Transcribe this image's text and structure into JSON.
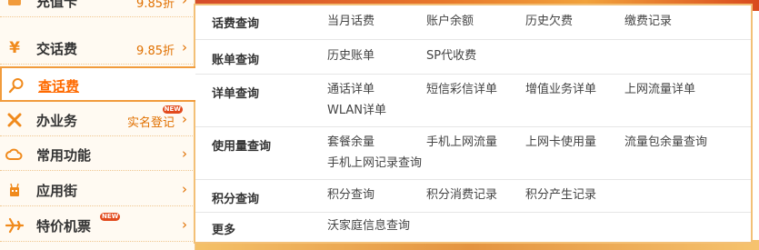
{
  "colors": {
    "accent": "#ff6a00",
    "popup_border": "#f3c077",
    "menu_background": "#fffaf2"
  },
  "left_menu": {
    "items": [
      {
        "label": "充值卡",
        "extra": "9.85折",
        "icon": "card-icon",
        "arrow": "›"
      },
      {
        "label": "交话费",
        "extra": "9.85折",
        "icon": "yuan-icon",
        "arrow": "›"
      },
      {
        "label": "查话费",
        "extra": "",
        "icon": "search-icon",
        "arrow": ""
      },
      {
        "label": "办业务",
        "extra": "实名登记",
        "icon": "tools-icon",
        "arrow": "›",
        "badge": "NEW"
      },
      {
        "label": "常用功能",
        "extra": "",
        "icon": "cloud-icon",
        "arrow": "›"
      },
      {
        "label": "应用街",
        "extra": "",
        "icon": "robot-icon",
        "arrow": "›"
      },
      {
        "label": "特价机票",
        "extra": "",
        "icon": "plane-icon",
        "arrow": "›",
        "badge": "NEW"
      }
    ]
  },
  "popup": {
    "rows": [
      {
        "title": "话费查询",
        "links": [
          "当月话费",
          "账户余额",
          "历史欠费",
          "缴费记录"
        ]
      },
      {
        "title": "账单查询",
        "links": [
          "历史账单",
          "SP代收费"
        ]
      },
      {
        "title": "详单查询",
        "links": [
          "通话详单",
          "短信彩信详单",
          "增值业务详单",
          "上网流量详单",
          "WLAN详单"
        ]
      },
      {
        "title": "使用量查询",
        "links": [
          "套餐余量",
          "手机上网流量",
          "上网卡使用量",
          "流量包余量查询",
          "手机上网记录查询"
        ]
      },
      {
        "title": "积分查询",
        "links": [
          "积分查询",
          "积分消费记录",
          "积分产生记录"
        ]
      },
      {
        "title": "更多",
        "links": [
          "沃家庭信息查询"
        ]
      }
    ]
  }
}
